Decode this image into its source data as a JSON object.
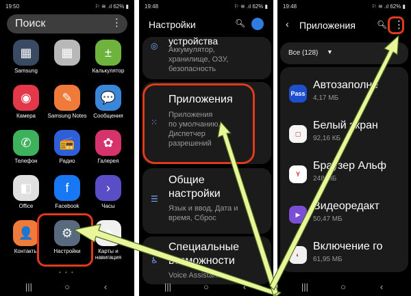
{
  "panel_home": {
    "status": {
      "time": "19:50",
      "signal": "⚐ ≋ .ıl 62% ▮"
    },
    "search": {
      "label": "Поиск",
      "menu": "⋮"
    },
    "apps": [
      {
        "name": "Samsung",
        "icon": "▦",
        "color": "#3a4a63"
      },
      {
        "name": "",
        "icon": "▦",
        "color": "#b8b8b8"
      },
      {
        "name": "Калькулятор",
        "icon": "±",
        "color": "#6fb33f"
      },
      {
        "name": "Камера",
        "icon": "◉",
        "color": "#e2384a"
      },
      {
        "name": "Samsung Notes",
        "icon": "✎",
        "color": "#f07a3a"
      },
      {
        "name": "Сообщения",
        "icon": "💬",
        "color": "#3a86d9"
      },
      {
        "name": "Телефон",
        "icon": "✆",
        "color": "#3eb15d"
      },
      {
        "name": "Радио",
        "icon": "📻",
        "color": "#2f5fd6"
      },
      {
        "name": "Галерея",
        "icon": "✿",
        "color": "#d6336c"
      },
      {
        "name": "Office",
        "icon": "◧",
        "color": "#e0e0e0"
      },
      {
        "name": "Facebook",
        "icon": "f",
        "color": "#1877f2"
      },
      {
        "name": "Часы",
        "icon": "›",
        "color": "#5a4ec7"
      },
      {
        "name": "Контакты",
        "icon": "👤",
        "color": "#f07a3a"
      },
      {
        "name": "Настройки",
        "icon": "⚙",
        "color": "#5a6a7e"
      },
      {
        "name": "Карты и навигация",
        "icon": "◆",
        "color": "#f0f0f0"
      }
    ],
    "page_dots": "• • •"
  },
  "panel_settings": {
    "status": {
      "time": "19:48",
      "signal": "⚐ ≋ .ıl 62% ▮"
    },
    "title": "Настройки",
    "items": [
      {
        "title": "устройства",
        "subtitle": "Аккумулятор,\nхранилище, ОЗУ,\nбезопасность"
      },
      {
        "title": "Приложения",
        "subtitle": "Приложения\nпо умолчанию,\nДиспетчер\nразрешений"
      },
      {
        "title": "Общие\nнастройки",
        "subtitle": "Язык и ввод, Дата и\nвремя, Сброс"
      },
      {
        "title": "Специальные\nвозможности",
        "subtitle": "Voice Assistant"
      }
    ]
  },
  "panel_apps": {
    "status": {
      "time": "19:48",
      "signal": "⚐ ≋ .ıl 62% ▮"
    },
    "title": "Приложения",
    "filter": "Все (128)",
    "apps": [
      {
        "name": "Автозаполне",
        "size": "4,17 МБ",
        "icon": "Pass",
        "color": "#1f4fcf"
      },
      {
        "name": "Белый экран",
        "size": "92,16 КБ",
        "icon": "▢",
        "color": "#f5f5f5"
      },
      {
        "name": "Браузер Альф",
        "size": "248 МБ",
        "icon": "Y",
        "color": "#ffffff"
      },
      {
        "name": "Видеоредакт",
        "size": "50,47 МБ",
        "icon": "▶",
        "color": "#7a4fd6"
      },
      {
        "name": "Включение го",
        "size": "61,95 МБ",
        "icon": "◐",
        "color": "#f0f0f0"
      }
    ]
  },
  "nav": {
    "recents": "|||",
    "home": "○",
    "back": "‹"
  }
}
